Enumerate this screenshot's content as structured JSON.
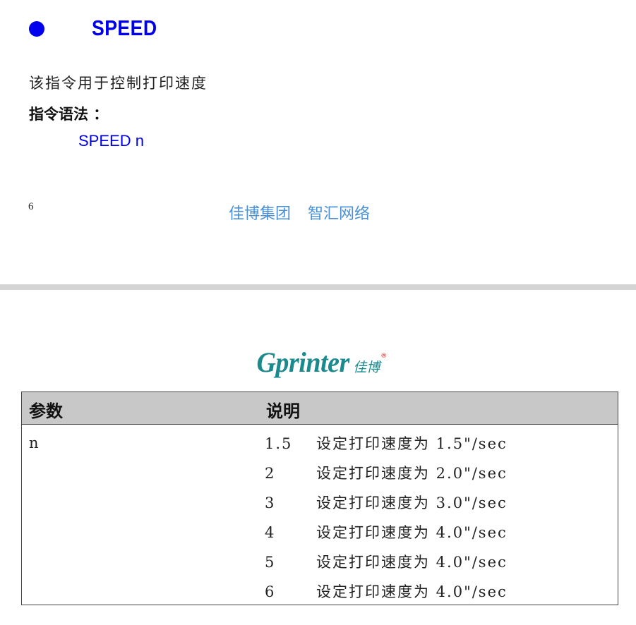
{
  "section": {
    "title": "SPEED",
    "description": "该指令用于控制打印速度",
    "syntax_label": "指令语法 ：",
    "syntax": "SPEED n"
  },
  "page": {
    "number": "6",
    "footer": [
      "佳博集团",
      "智汇网络"
    ]
  },
  "logo": {
    "main": "Gprinter",
    "cn": "佳博",
    "reg": "®"
  },
  "table": {
    "headers": [
      "参数",
      "说明"
    ],
    "param": "n",
    "rows": [
      {
        "value": "1.5",
        "text": "设定打印速度为 1.5\"/sec"
      },
      {
        "value": "2",
        "text": "设定打印速度为 2.0\"/sec"
      },
      {
        "value": "3",
        "text": "设定打印速度为 3.0\"/sec"
      },
      {
        "value": "4",
        "text": "设定打印速度为 4.0\"/sec"
      },
      {
        "value": "5",
        "text": "设定打印速度为 4.0\"/sec"
      },
      {
        "value": "6",
        "text": "设定打印速度为 4.0\"/sec"
      }
    ]
  },
  "colors": {
    "title": "#0000ee",
    "footer": "#4a90d6",
    "logo": "#1b8a8e",
    "table_header": "#c8c8c8"
  }
}
